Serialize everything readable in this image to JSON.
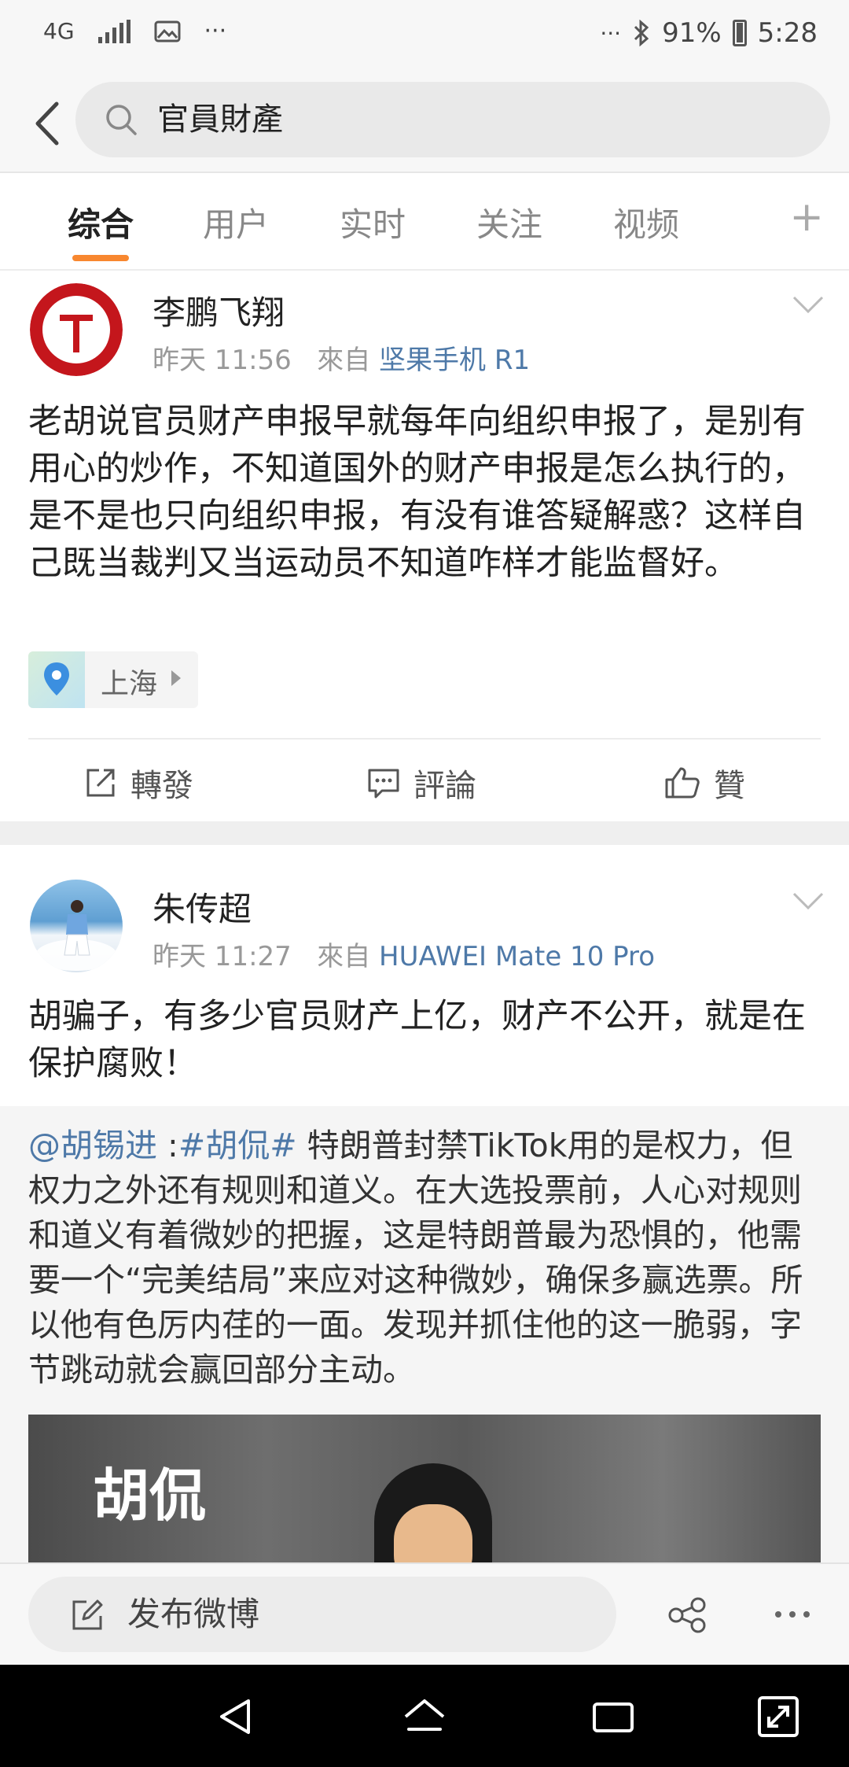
{
  "status_bar": {
    "network": "4G",
    "overflow": "···",
    "right_overflow": "···",
    "battery": "91%",
    "time": "5:28"
  },
  "search": {
    "query": "官員財產"
  },
  "tabs": [
    {
      "label": "综合",
      "active": true
    },
    {
      "label": "用户",
      "active": false
    },
    {
      "label": "实时",
      "active": false
    },
    {
      "label": "关注",
      "active": false
    },
    {
      "label": "视频",
      "active": false
    }
  ],
  "tab_add": "+",
  "posts": [
    {
      "username": "李鹏飞翔",
      "time": "昨天 11:56",
      "from": "來自",
      "source": "坚果手机 R1",
      "text": "老胡说官员财产申报早就每年向组织申报了，是别有用心的炒作，不知道国外的财产申报是怎么执行的，是不是也只向组织申报，有没有谁答疑解惑？这样自己既当裁判又当运动员不知道咋样才能监督好。",
      "location": "上海",
      "actions": {
        "repost": "轉發",
        "comment": "評論",
        "like": "贊"
      }
    },
    {
      "username": "朱传超",
      "time": "昨天 11:27",
      "from": "來自",
      "source": "HUAWEI Mate 10 Pro",
      "text": "胡骗子，有多少官员财产上亿，财产不公开，就是在保护腐败！",
      "quote": {
        "mention": "@胡锡进",
        "separator": " :",
        "hashtag": "#胡侃#",
        "text": " 特朗普封禁TikTok用的是权力，但权力之外还有规则和道义。在大选投票前，人心对规则和道义有着微妙的把握，这是特朗普最为恐惧的，他需要一个“完美结局”来应对这种微妙，确保多赢选票。所以他有色厉内荏的一面。发现并抓住他的这一脆弱，字节跳动就会赢回部分主动。",
        "image_logo": "胡侃"
      }
    }
  ],
  "compose": {
    "label": "发布微博"
  }
}
